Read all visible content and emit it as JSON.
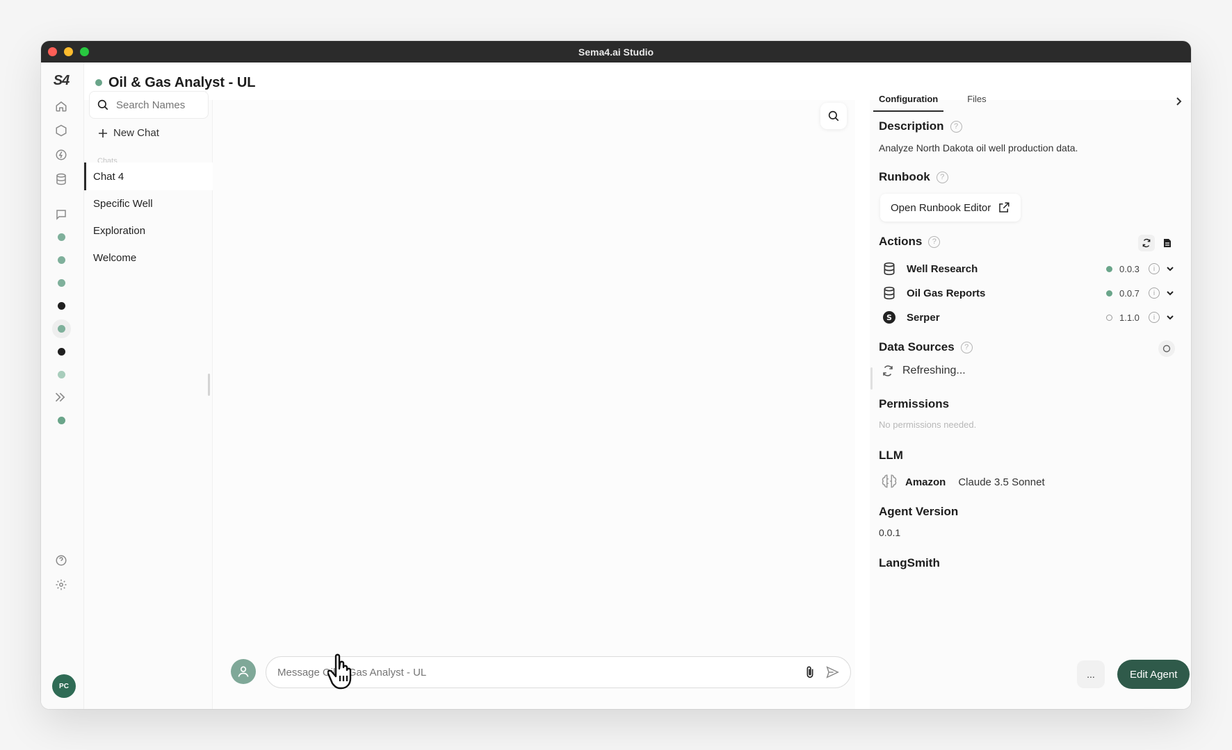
{
  "window": {
    "title": "Sema4.ai Studio"
  },
  "rail": {
    "logo": "S4",
    "avatar_initials": "PC"
  },
  "agent": {
    "name": "Oil & Gas Analyst - UL"
  },
  "chatlist": {
    "search_placeholder": "Search Names",
    "new_chat_label": "New Chat",
    "section_label": "Chats",
    "items": [
      "Chat 4",
      "Specific Well",
      "Exploration",
      "Welcome"
    ],
    "active_index": 0
  },
  "composer": {
    "placeholder": "Message Oil & Gas Analyst - UL"
  },
  "config": {
    "tabs": [
      "Configuration",
      "Files"
    ],
    "active_tab": "Configuration",
    "description": {
      "heading": "Description",
      "text": "Analyze North Dakota oil well production data."
    },
    "runbook": {
      "heading": "Runbook",
      "button_label": "Open Runbook Editor"
    },
    "actions": {
      "heading": "Actions",
      "items": [
        {
          "name": "Well Research",
          "version": "0.0.3",
          "status": "active"
        },
        {
          "name": "Oil Gas Reports",
          "version": "0.0.7",
          "status": "active"
        },
        {
          "name": "Serper",
          "version": "1.1.0",
          "status": "inactive"
        }
      ]
    },
    "data_sources": {
      "heading": "Data Sources",
      "status_text": "Refreshing..."
    },
    "permissions": {
      "heading": "Permissions",
      "text": "No permissions needed."
    },
    "llm": {
      "heading": "LLM",
      "provider": "Amazon",
      "model": "Claude 3.5 Sonnet"
    },
    "agent_version": {
      "heading": "Agent Version",
      "value": "0.0.1"
    },
    "langsmith": {
      "heading": "LangSmith"
    },
    "footer": {
      "more_label": "...",
      "edit_label": "Edit Agent"
    }
  },
  "colors": {
    "accent": "#2f5a4a",
    "status_green": "#6aa58a",
    "titlebar": "#2b2b2b"
  }
}
